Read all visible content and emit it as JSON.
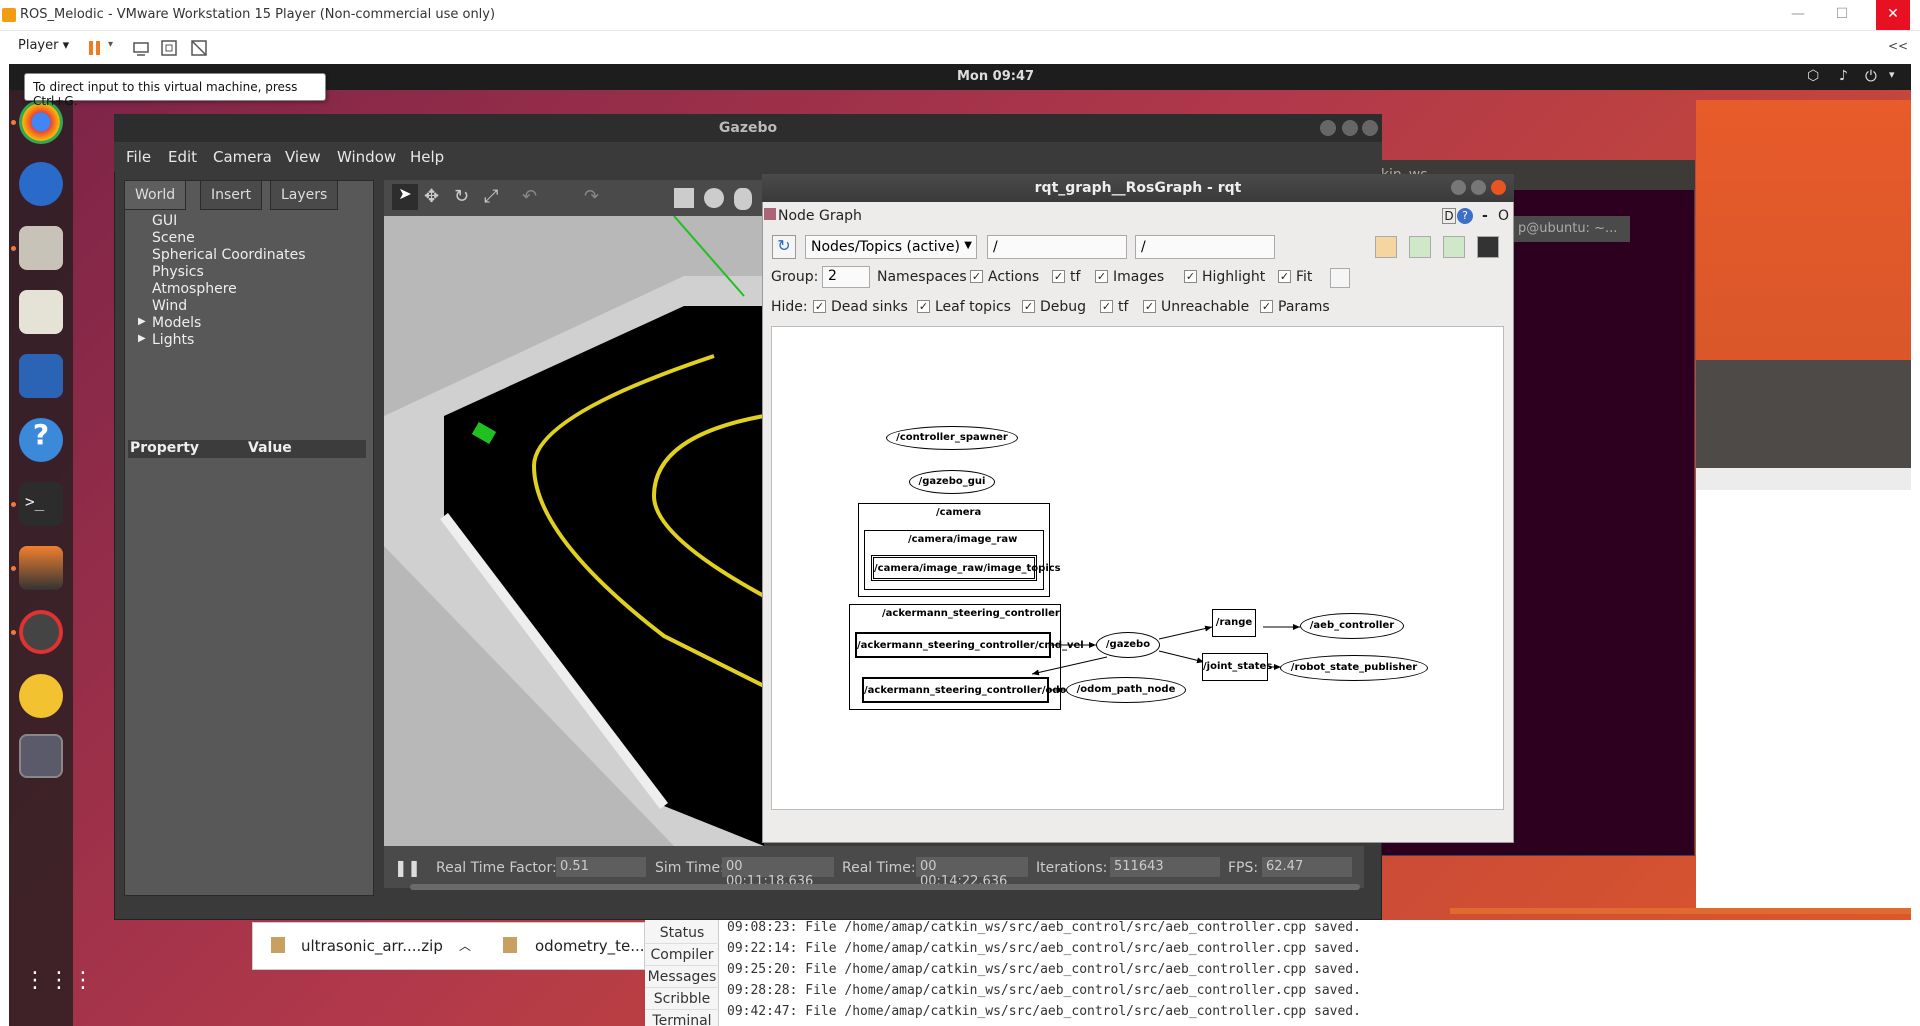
{
  "vm": {
    "title": "ROS_Melodic - VMware Workstation 15 Player (Non-commercial use only)",
    "player_label": "Player ▾",
    "tooltip": "To direct input to this virtual machine, press Ctrl+G.",
    "min_btn": "—",
    "max_btn": "☐",
    "close_btn": "✕",
    "collapse_btn": "<<"
  },
  "ubuntu": {
    "clock": "Mon 09:47",
    "terminal_tab": "p@ubuntu: ~...",
    "terminal_title": "amap@ubuntu: ~/catkin_ws"
  },
  "files_bar": {
    "item1": "ultrasonic_arr....zip",
    "item2": "odometry_te..."
  },
  "gedit": {
    "tabs": [
      "Status",
      "Compiler",
      "Messages",
      "Scribble",
      "Terminal"
    ],
    "log": [
      "09:08:23: File /home/amap/catkin_ws/src/aeb_control/src/aeb_controller.cpp saved.",
      "09:22:14: File /home/amap/catkin_ws/src/aeb_control/src/aeb_controller.cpp saved.",
      "09:25:20: File /home/amap/catkin_ws/src/aeb_control/src/aeb_controller.cpp saved.",
      "09:28:28: File /home/amap/catkin_ws/src/aeb_control/src/aeb_controller.cpp saved.",
      "09:42:47: File /home/amap/catkin_ws/src/aeb_control/src/aeb_controller.cpp saved."
    ]
  },
  "gazebo": {
    "title": "Gazebo",
    "menu": [
      "File",
      "Edit",
      "Camera",
      "View",
      "Window",
      "Help"
    ],
    "tabs": [
      "World",
      "Insert",
      "Layers"
    ],
    "tree": [
      "GUI",
      "Scene",
      "Spherical Coordinates",
      "Physics",
      "Atmosphere",
      "Wind",
      "Models",
      "Lights"
    ],
    "prop_header": [
      "Property",
      "Value"
    ],
    "status": {
      "rtf_label": "Real Time Factor:",
      "rtf": "0.51",
      "sim_label": "Sim Time:",
      "sim": "00 00:11:18.636",
      "real_label": "Real Time:",
      "real": "00 00:14:22.636",
      "iter_label": "Iterations:",
      "iter": "511643",
      "fps_label": "FPS:",
      "fps": "62.47"
    }
  },
  "rqt": {
    "title": "rqt_graph__RosGraph - rqt",
    "panel": "Node Graph",
    "combo": "Nodes/Topics (active)",
    "filter1": "/",
    "filter2": "/",
    "group_label": "Group:",
    "group_value": "2",
    "row1": [
      "Namespaces",
      "Actions",
      "tf",
      "Images",
      "Highlight",
      "Fit"
    ],
    "hide_label": "Hide:",
    "row2": [
      "Dead sinks",
      "Leaf topics",
      "Debug",
      "tf",
      "Unreachable",
      "Params"
    ],
    "corner": "D",
    "nodes": {
      "controller_spawner": "/controller_spawner",
      "gazebo_gui": "/gazebo_gui",
      "camera": "/camera",
      "image_raw": "/camera/image_raw",
      "image_topics": "/camera/image_raw/image_topics",
      "ack": "/ackermann_steering_controller",
      "cmd_vel": "/ackermann_steering_controller/cmd_vel",
      "odom": "/ackermann_steering_controller/odom",
      "gazebo": "/gazebo",
      "range": "/range",
      "aeb": "/aeb_controller",
      "joint_states": "/joint_states",
      "rsp": "/robot_state_publisher",
      "odom_path": "/odom_path_node"
    }
  }
}
